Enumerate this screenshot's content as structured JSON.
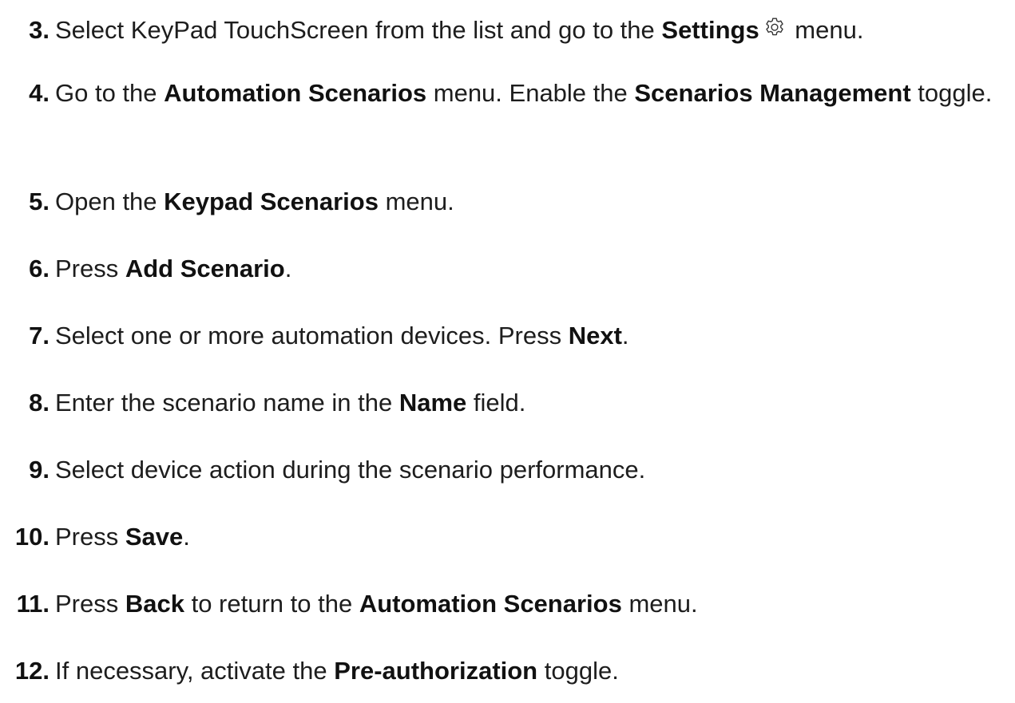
{
  "steps": [
    {
      "number": "3.",
      "segments": [
        {
          "text": "Select KeyPad TouchScreen from the list and go to the ",
          "bold": false
        },
        {
          "text": "Settings",
          "bold": true
        },
        {
          "icon": "gear-icon"
        },
        {
          "text": " menu.",
          "bold": false
        }
      ]
    },
    {
      "number": "4.",
      "segments": [
        {
          "text": "Go to the ",
          "bold": false
        },
        {
          "text": "Automation Scenarios",
          "bold": true
        },
        {
          "text": " menu. Enable the ",
          "bold": false
        },
        {
          "text": "Scenarios Management",
          "bold": true
        },
        {
          "text": " toggle.",
          "bold": false
        }
      ]
    },
    {
      "number": "5.",
      "segments": [
        {
          "text": "Open the ",
          "bold": false
        },
        {
          "text": "Keypad Scenarios",
          "bold": true
        },
        {
          "text": " menu.",
          "bold": false
        }
      ]
    },
    {
      "number": "6.",
      "segments": [
        {
          "text": "Press ",
          "bold": false
        },
        {
          "text": "Add Scenario",
          "bold": true
        },
        {
          "text": ".",
          "bold": false
        }
      ]
    },
    {
      "number": "7.",
      "segments": [
        {
          "text": "Select one or more automation devices. Press ",
          "bold": false
        },
        {
          "text": "Next",
          "bold": true
        },
        {
          "text": ".",
          "bold": false
        }
      ]
    },
    {
      "number": "8.",
      "segments": [
        {
          "text": "Enter the scenario name in the ",
          "bold": false
        },
        {
          "text": "Name",
          "bold": true
        },
        {
          "text": " field.",
          "bold": false
        }
      ]
    },
    {
      "number": "9.",
      "segments": [
        {
          "text": "Select device action during the scenario performance.",
          "bold": false
        }
      ]
    },
    {
      "number": "10.",
      "segments": [
        {
          "text": "Press ",
          "bold": false
        },
        {
          "text": "Save",
          "bold": true
        },
        {
          "text": ".",
          "bold": false
        }
      ]
    },
    {
      "number": "11.",
      "segments": [
        {
          "text": "Press ",
          "bold": false
        },
        {
          "text": "Back",
          "bold": true
        },
        {
          "text": " to return to the ",
          "bold": false
        },
        {
          "text": "Automation Scenarios",
          "bold": true
        },
        {
          "text": " menu.",
          "bold": false
        }
      ]
    },
    {
      "number": "12.",
      "segments": [
        {
          "text": "If necessary, activate the ",
          "bold": false
        },
        {
          "text": "Pre-authorization",
          "bold": true
        },
        {
          "text": " toggle.",
          "bold": false
        }
      ]
    }
  ]
}
